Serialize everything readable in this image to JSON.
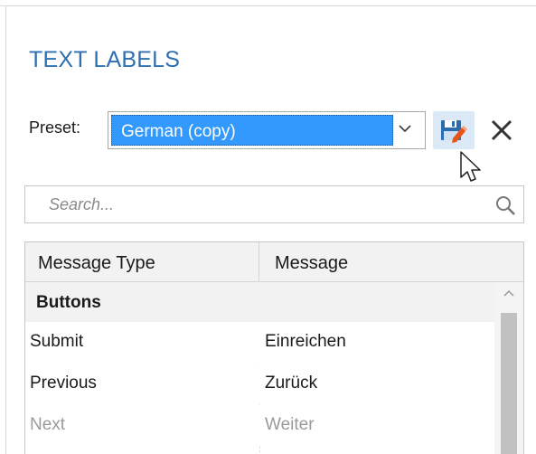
{
  "panel": {
    "title": "TEXT LABELS"
  },
  "preset": {
    "label": "Preset:",
    "selected": "German (copy)"
  },
  "search": {
    "placeholder": "Search..."
  },
  "table": {
    "columns": [
      "Message Type",
      "Message"
    ],
    "group": "Buttons",
    "rows": [
      {
        "type": "Submit",
        "message": "Einreichen"
      },
      {
        "type": "Previous",
        "message": "Zurück"
      },
      {
        "type": "Next",
        "message": "Weiter"
      }
    ]
  },
  "icons": {
    "save": "save-edit-icon",
    "close": "close-icon",
    "search": "search-icon",
    "dropdown": "chevron-down-icon",
    "scroll_up": "chevron-up-icon"
  },
  "colors": {
    "title": "#2f6fb0",
    "selection": "#3399ff",
    "save_button_bg": "#dbe9f7",
    "save_icon_blue": "#2b6cb0",
    "save_icon_pencil": "#e8541a"
  }
}
